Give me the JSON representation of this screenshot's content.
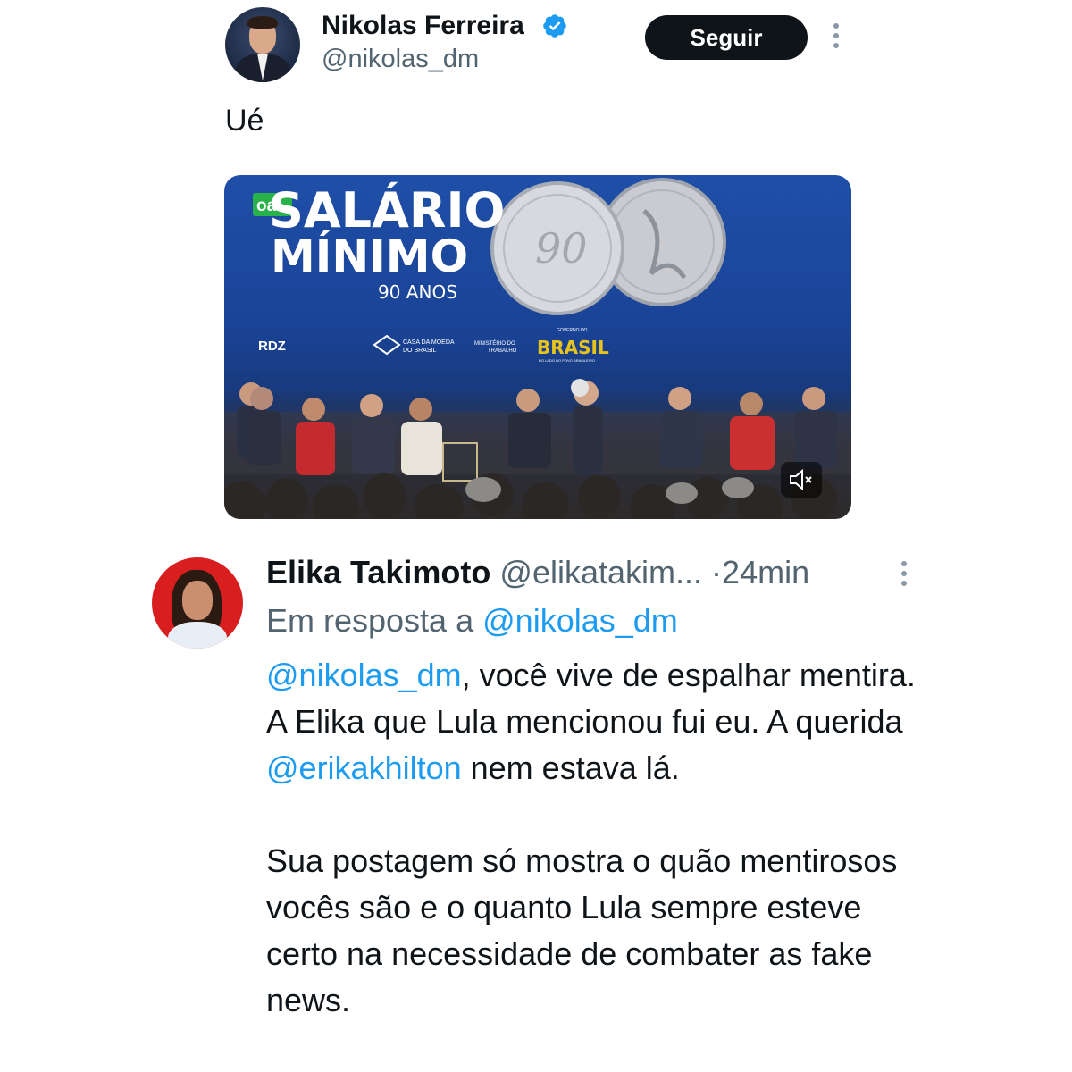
{
  "tweet": {
    "author_name": "Nikolas Ferreira",
    "author_handle": "@nikolas_dm",
    "follow_label": "Seguir",
    "text": "Ué",
    "verified_icon": "verified-badge-icon",
    "media": {
      "banner_line1": "SALÁRIO",
      "banner_line2": "MÍNIMO",
      "banner_line3": "90 ANOS",
      "badge": "oa!",
      "rdz": "RDZ",
      "logo1_line1": "CASA DA MOEDA",
      "logo1_line2": "DO BRASIL",
      "logo2_line1": "MINISTÉRIO DO",
      "logo2_line2": "TRABALHO",
      "logo3_top": "GOVERNO DO",
      "logo3_main": "BRASIL",
      "logo3_bottom": "DO LADO DO POVO BRASILEIRO",
      "mute_icon": "muted-speaker-icon"
    }
  },
  "reply": {
    "author_name": "Elika Takimoto",
    "author_handle": "@elikatakim...",
    "separator": "·",
    "time": "24min",
    "in_reply_prefix": "Em resposta a",
    "in_reply_handle": "@nikolas_dm",
    "mention1": "@nikolas_dm",
    "text_part1": ", você vive de espalhar mentira. A Elika que Lula mencionou fui eu. A querida ",
    "mention2": "@erikakhilton",
    "text_part2": " nem estava lá.",
    "paragraph2": "Sua postagem só mostra o quão mentirosos vocês são e o quanto Lula sempre esteve certo na necessidade de combater as fake news."
  },
  "colors": {
    "link": "#1d9bf0",
    "secondary_text": "#536471",
    "primary_text": "#0f1419",
    "button_bg": "#0f1419",
    "verified": "#1d9bf0"
  }
}
